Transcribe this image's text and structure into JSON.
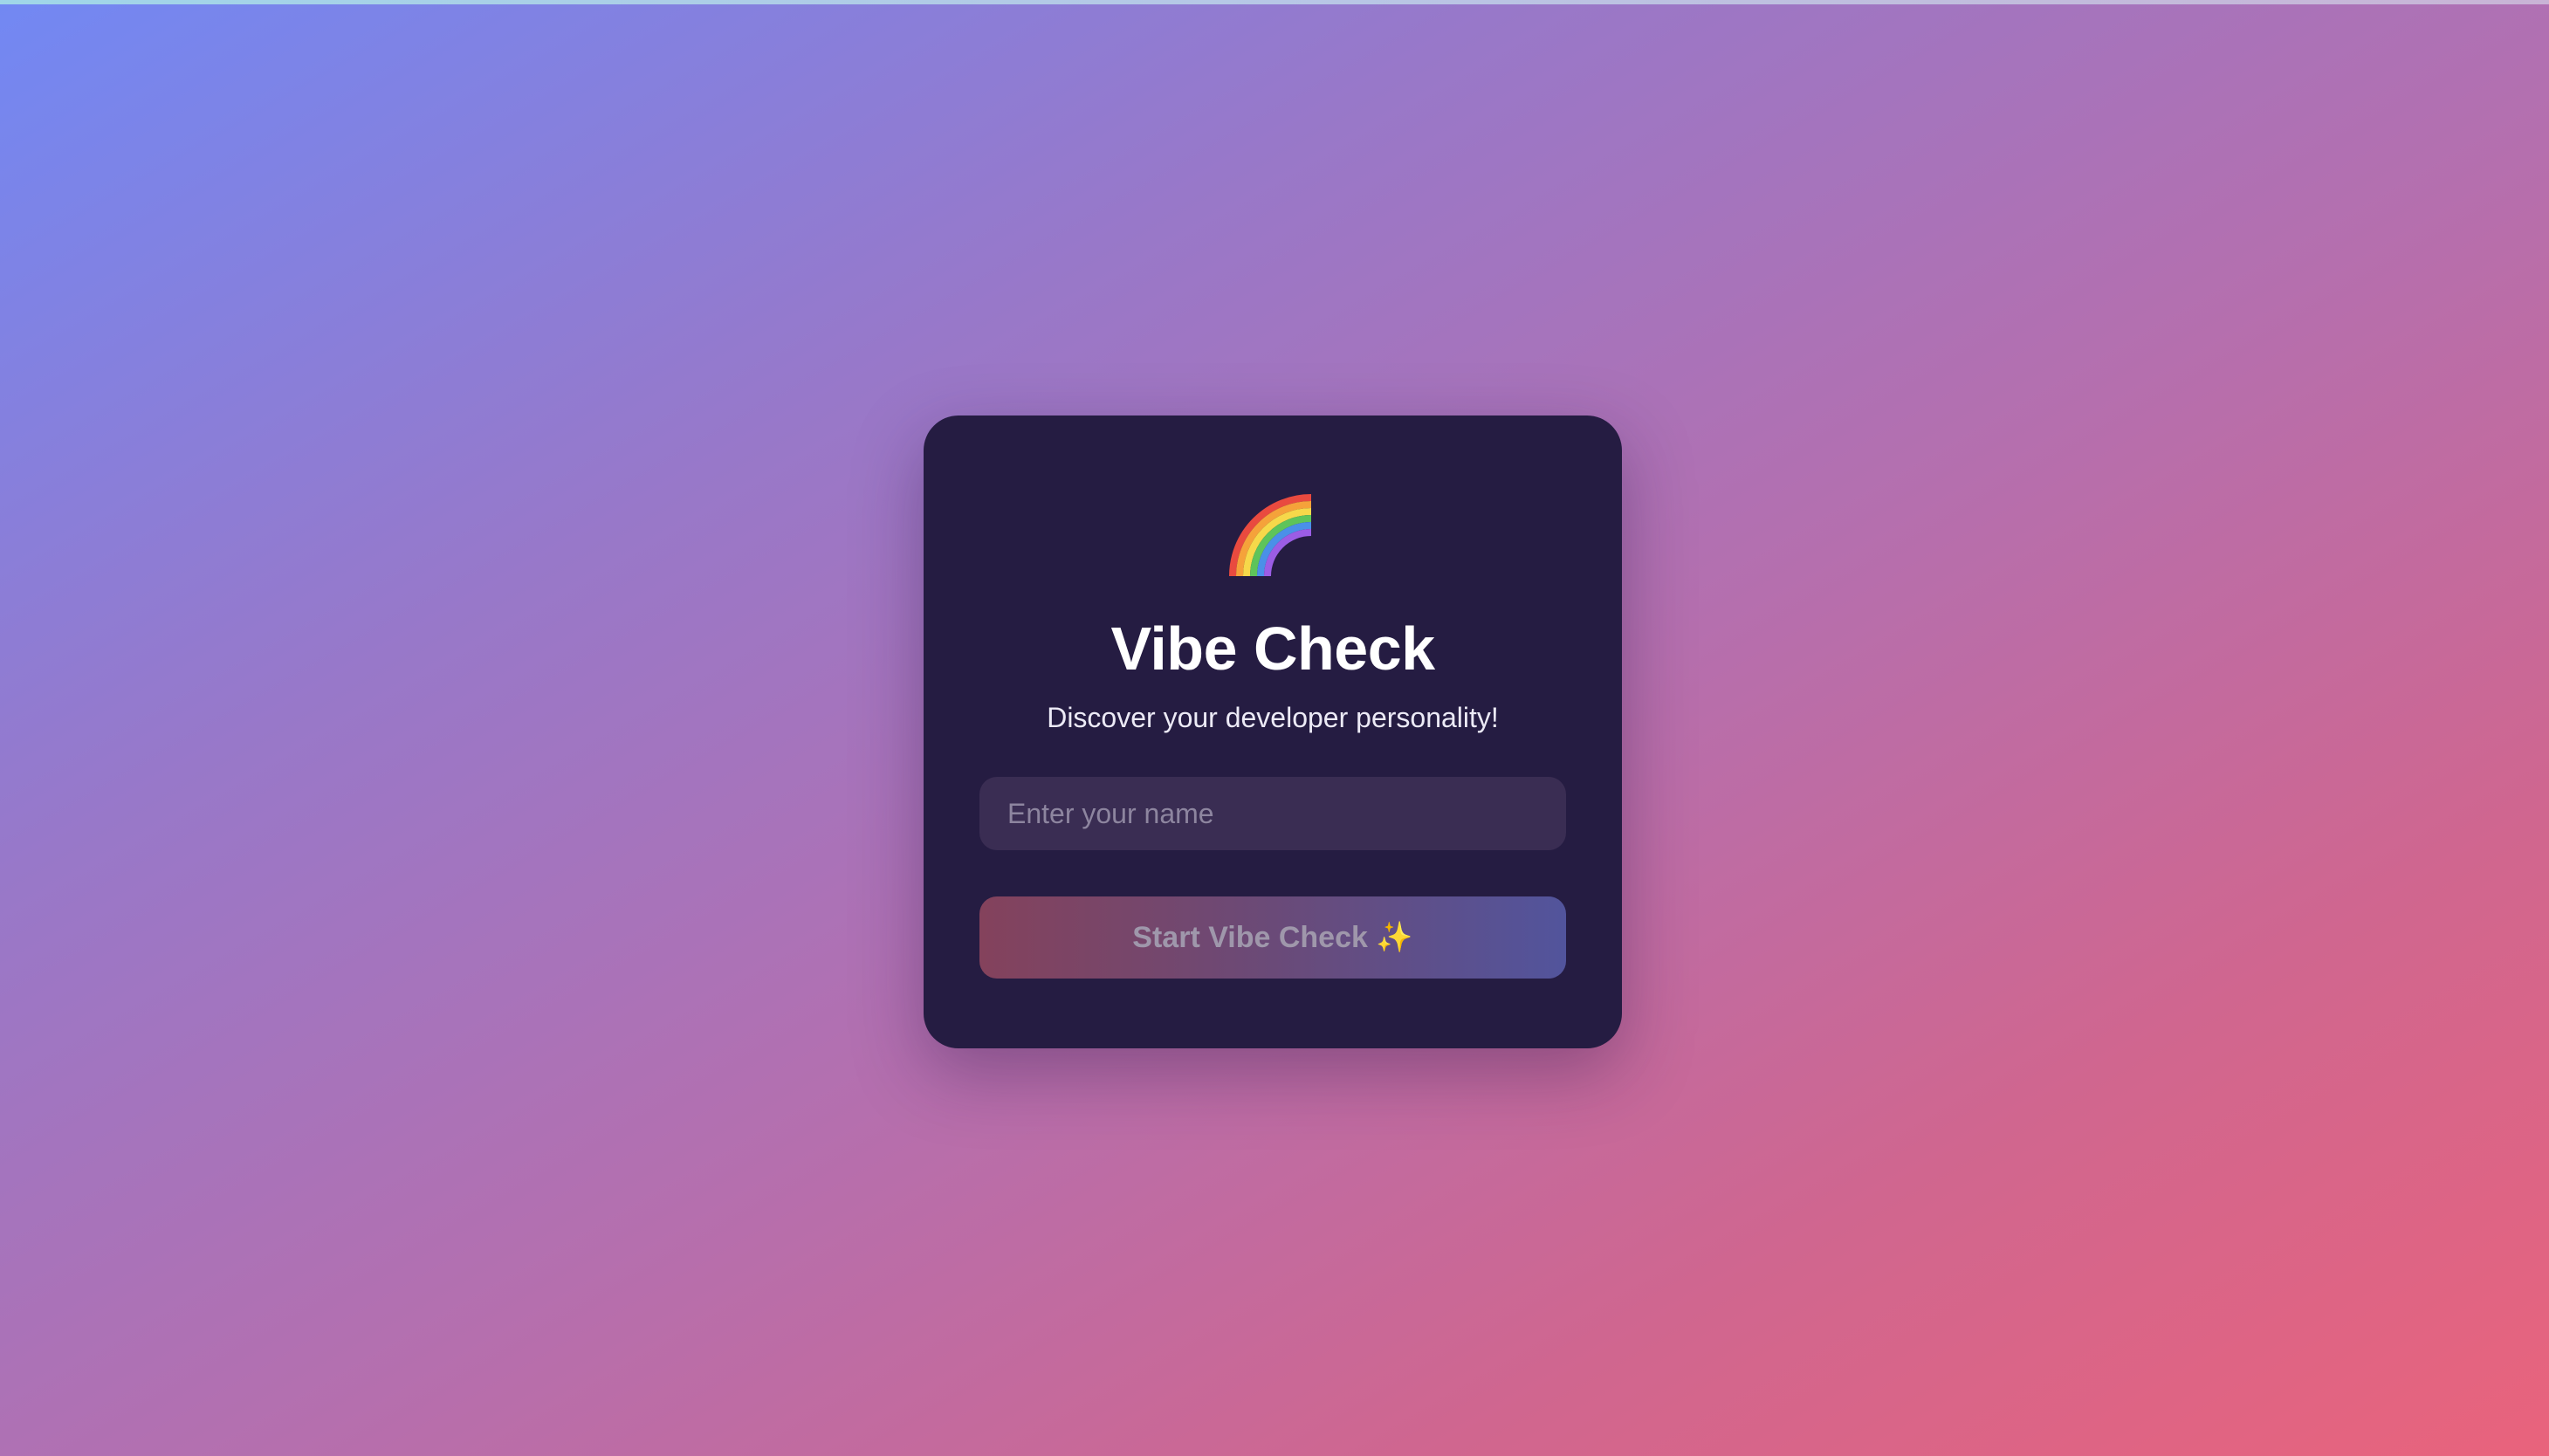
{
  "app": {
    "logo_icon": "rainbow-icon",
    "title": "Vibe Check",
    "subtitle": "Discover your developer personality!"
  },
  "form": {
    "name_input": {
      "value": "",
      "placeholder": "Enter your name"
    },
    "start_button": {
      "label": "Start Vibe Check",
      "icon": "sparkles-icon",
      "icon_glyph": "✨",
      "enabled": false
    }
  },
  "colors": {
    "background_start": "#7288f3",
    "background_end": "#e9637c",
    "card": "#251c42",
    "input_bg": "#3a2d53",
    "button_start": "#84425c",
    "button_end": "#52549c"
  }
}
